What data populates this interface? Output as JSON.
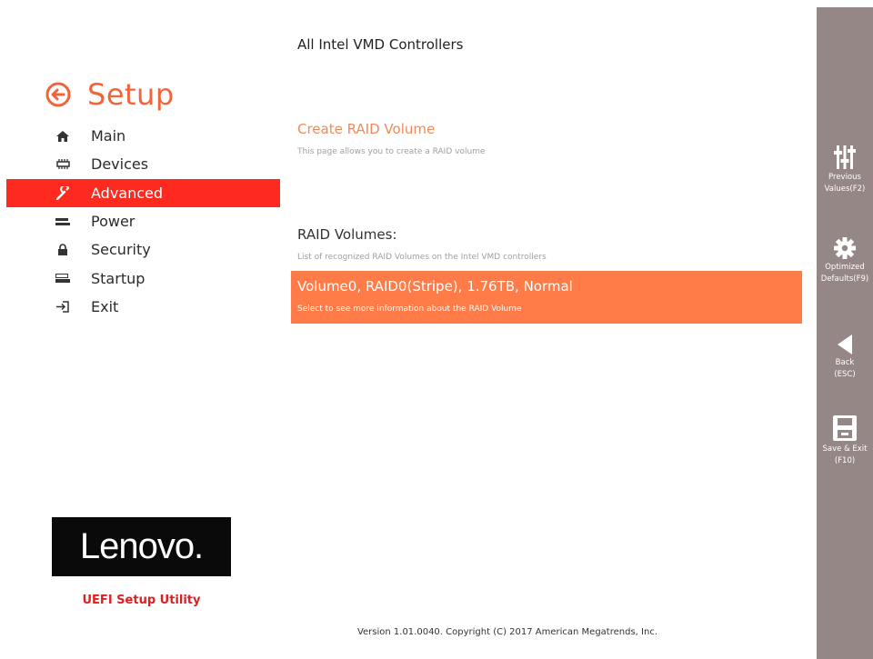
{
  "sidebar": {
    "title": "Setup",
    "items": [
      {
        "label": "Main",
        "icon": "home-icon"
      },
      {
        "label": "Devices",
        "icon": "devices-icon"
      },
      {
        "label": "Advanced",
        "icon": "wrench-icon",
        "active": true
      },
      {
        "label": "Power",
        "icon": "power-icon"
      },
      {
        "label": "Security",
        "icon": "lock-icon"
      },
      {
        "label": "Startup",
        "icon": "startup-icon"
      },
      {
        "label": "Exit",
        "icon": "exit-icon"
      }
    ],
    "logo": "Lenovo.",
    "utility_label": "UEFI Setup Utility"
  },
  "main": {
    "page_title": "All Intel VMD Controllers",
    "create_raid": {
      "title": "Create RAID Volume",
      "description": "This page allows you to create a RAID volume"
    },
    "raid_volumes": {
      "title": "RAID Volumes:",
      "description": "List of recognized RAID Volumes on the Intel VMD controllers",
      "items": [
        {
          "title": "Volume0, RAID0(Stripe), 1.76TB, Normal",
          "description": "Select to see more information about the RAID Volume"
        }
      ]
    },
    "version": "Version 1.01.0040. Copyright (C) 2017 American Megatrends, Inc."
  },
  "actions": [
    {
      "icon": "sliders-icon",
      "label": "Previous\nValues(F2)"
    },
    {
      "icon": "gear-icon",
      "label": "Optimized\nDefaults(F9)"
    },
    {
      "icon": "back-arrow-icon",
      "label": "Back\n(ESC)"
    },
    {
      "icon": "save-icon",
      "label": "Save & Exit\n(F10)"
    }
  ],
  "colors": {
    "accent": "#f0663a",
    "active_nav": "#ff2a1f",
    "selected_row": "#ff7b47",
    "action_bar": "#948786",
    "utility_label": "#e02020"
  }
}
